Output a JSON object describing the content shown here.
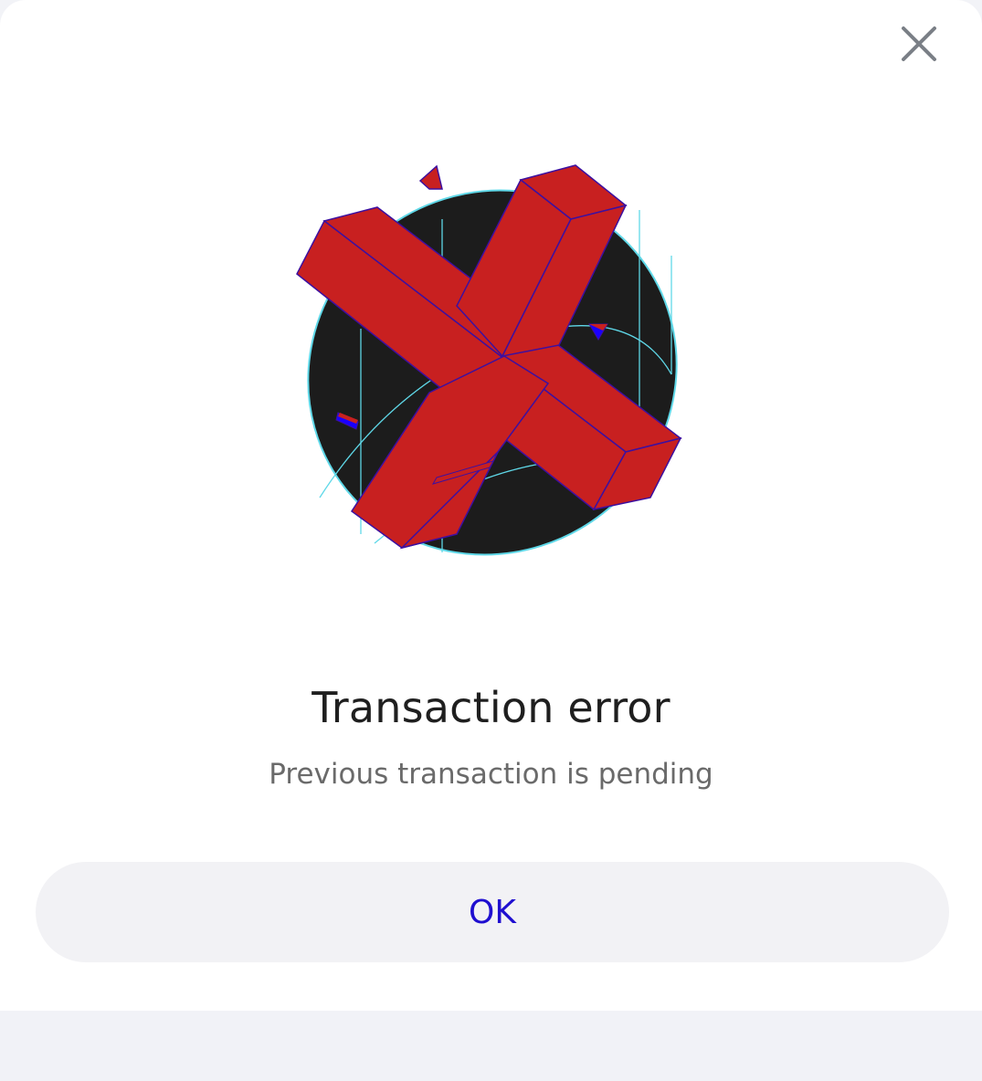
{
  "dialog": {
    "title": "Transaction error",
    "message": "Previous transaction is pending",
    "ok_label": "OK",
    "close_icon": "close-icon",
    "illustration_icon": "error-x-illustration"
  },
  "colors": {
    "accent": "#1f0fd0",
    "error_red": "#c82020",
    "outline_blue": "#1a00ff",
    "dark_disc": "#1c1c1c",
    "cyan_line": "#5fd8e8"
  }
}
